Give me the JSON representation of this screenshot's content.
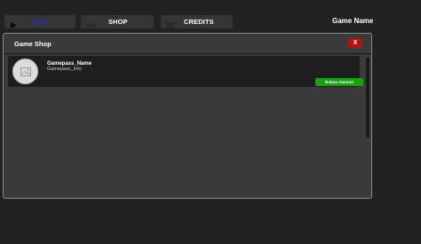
{
  "nav": {
    "play_label": "PLAY",
    "shop_label": "SHOP",
    "credits_label": "CREDITS",
    "play_icon": "play-icon",
    "shop_icon": "shop-icon",
    "credits_icon": "credits-icon"
  },
  "header": {
    "game_name": "Game Name"
  },
  "shop": {
    "title": "Game Shop",
    "close_label": "X",
    "items": [
      {
        "name": "Gamepass_Name",
        "info": "Gamepass_Info",
        "button_label": "Robux Amount",
        "image_icon": "image-icon"
      }
    ]
  },
  "colors": {
    "background": "#222222",
    "panel": "#3a3a3a",
    "play_text": "#1f2fd6",
    "close_red": "#b01212",
    "buy_green": "#17a012"
  }
}
